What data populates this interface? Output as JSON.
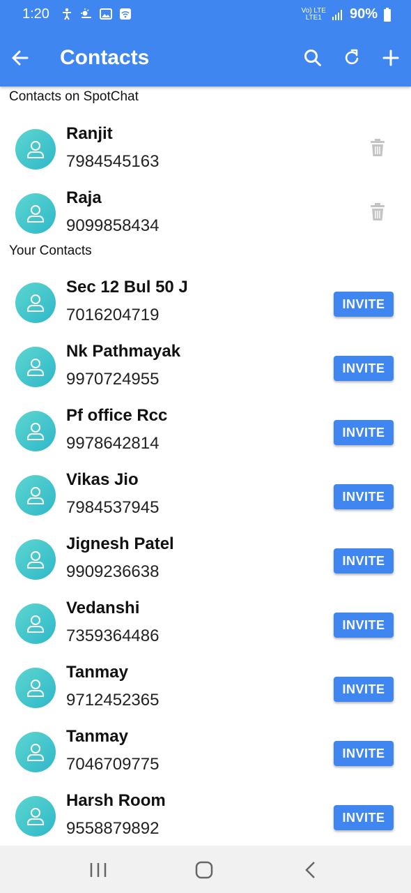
{
  "status_bar": {
    "time": "1:20",
    "net_top": "Vo) LTE",
    "net_bottom": "LTE1",
    "battery": "90%"
  },
  "toolbar": {
    "title": "Contacts",
    "icons": [
      "back-arrow-icon",
      "search-icon",
      "refresh-icon",
      "add-icon"
    ]
  },
  "sections": {
    "spotchat_header": "Contacts on SpotChat",
    "your_header": "Your Contacts"
  },
  "spotchat_contacts": [
    {
      "name": "Ranjit",
      "phone": "7984545163"
    },
    {
      "name": "Raja",
      "phone": "9099858434"
    }
  ],
  "your_contacts": [
    {
      "name": "Sec 12 Bul 50 J",
      "phone": "7016204719"
    },
    {
      "name": "Nk Pathmayak",
      "phone": "9970724955"
    },
    {
      "name": "Pf office Rcc",
      "phone": "9978642814"
    },
    {
      "name": "Vikas Jio",
      "phone": "7984537945"
    },
    {
      "name": "Jignesh Patel",
      "phone": "9909236638"
    },
    {
      "name": "Vedanshi",
      "phone": "7359364486"
    },
    {
      "name": "Tanmay",
      "phone": "9712452365"
    },
    {
      "name": "Tanmay",
      "phone": "7046709775"
    },
    {
      "name": "Harsh Room",
      "phone": "9558879892"
    }
  ],
  "invite_label": "INVITE",
  "colors": {
    "accent": "#3f86f0",
    "avatar": "#3cc5cc",
    "trash": "#c4c4c4"
  }
}
